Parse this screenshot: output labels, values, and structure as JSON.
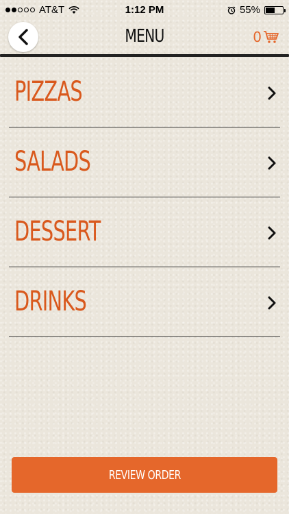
{
  "status_bar": {
    "carrier": "AT&T",
    "time": "1:12 PM",
    "battery": "55%",
    "battery_level": 0.55,
    "signal_filled": 2,
    "signal_total": 5
  },
  "header": {
    "title": "MENU",
    "cart_count": "0",
    "back_icon": "chevron-left-icon",
    "cart_icon": "shopping-cart-icon"
  },
  "menu": {
    "items": [
      {
        "label": "PIZZAS"
      },
      {
        "label": "SALADS"
      },
      {
        "label": "DESSERT"
      },
      {
        "label": "DRINKS"
      }
    ]
  },
  "footer": {
    "review_label": "REVIEW ORDER"
  },
  "colors": {
    "accent": "#e5672b",
    "label": "#d9591d",
    "background": "#ebe6dc"
  }
}
